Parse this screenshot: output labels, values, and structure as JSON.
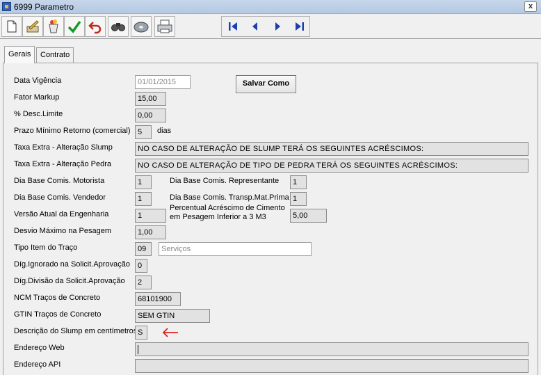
{
  "window": {
    "title": "6999 Parametro",
    "close_label": "x"
  },
  "toolbar": {
    "buttons": [
      "new-icon",
      "edit-icon",
      "cancel-icon",
      "confirm-icon",
      "undo-icon",
      "find-icon",
      "save-disk-icon",
      "print-icon"
    ],
    "nav": [
      "first-record-icon",
      "prev-record-icon",
      "next-record-icon",
      "last-record-icon"
    ]
  },
  "tabs": [
    "Gerais",
    "Contrato WEB"
  ],
  "buttons": {
    "salvar_como": "Salvar Como"
  },
  "fields": {
    "data_vigencia": {
      "label": "Data Vigência",
      "value": "01/01/2015"
    },
    "fator_markup": {
      "label": "Fator Markup",
      "value": "15,00"
    },
    "desc_limite": {
      "label": "% Desc.Limite",
      "value": "0,00"
    },
    "prazo_minimo": {
      "label": "Prazo Mínimo Retorno (comercial)",
      "value": "5",
      "unit": "dias"
    },
    "taxa_slump": {
      "label": "Taxa Extra - Alteração Slump",
      "value": "NO CASO DE ALTERAÇÃO DE SLUMP TERÁ OS SEGUINTES ACRÉSCIMOS:"
    },
    "taxa_pedra": {
      "label": "Taxa Extra - Alteração Pedra",
      "value": "NO CASO DE ALTERAÇÃO DE TIPO DE PEDRA TERÁ OS SEGUINTES ACRÉSCIMOS:"
    },
    "dia_motorista": {
      "label": "Dia Base Comis. Motorista",
      "value": "1"
    },
    "dia_representante": {
      "label": "Dia Base Comis. Representante",
      "value": "1"
    },
    "dia_vendedor": {
      "label": "Dia Base Comis. Vendedor",
      "value": "1"
    },
    "dia_transp": {
      "label": "Dia Base Comis. Transp.Mat.Prima",
      "value": "1"
    },
    "versao_engenharia": {
      "label": "Versão Atual da Engenharia",
      "value": "1"
    },
    "percentual_cimento": {
      "label_line1": "Percentual Acréscimo de Cimento",
      "label_line2": "em Pesagem Inferior a 3 M3",
      "value": "5,00"
    },
    "desvio_maximo": {
      "label": "Desvio Máximo na Pesagem",
      "value": "1,00"
    },
    "tipo_item": {
      "label": "Tipo Item do Traço",
      "code": "09",
      "description": "Serviços"
    },
    "dig_ignorado": {
      "label": "Díg.Ignorado na Solicit.Aprovação",
      "value": "0"
    },
    "dig_divisao": {
      "label": "Díg.Divisão da Solicit.Aprovação",
      "value": "2"
    },
    "ncm": {
      "label": "NCM Traços de Concreto",
      "value": "68101900"
    },
    "gtin": {
      "label": "GTIN Traços de Concreto",
      "value": "SEM GTIN"
    },
    "slump_cm": {
      "label": "Descrição do Slump em centímetros",
      "value": "S"
    },
    "endereco_web": {
      "label": "Endereço Web",
      "value": ""
    },
    "endereco_api": {
      "label": "Endereço API",
      "value": ""
    }
  },
  "colors": {
    "annotation_arrow": "#e02020",
    "nav_arrow": "#1a3fb0"
  }
}
